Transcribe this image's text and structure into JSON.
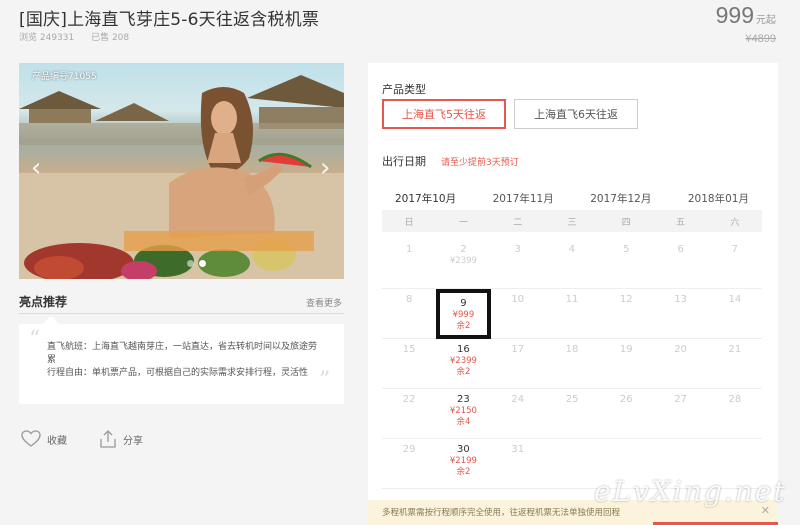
{
  "header": {
    "title": "[国庆]上海直飞芽庄5-6天往返含税机票",
    "views": "浏览 249331",
    "sold": "已售 208",
    "price": "999",
    "price_unit": "元起",
    "original_price": "¥4899"
  },
  "gallery": {
    "product_code": "产品编号71055",
    "prev_glyph": "‹",
    "next_glyph": "›"
  },
  "highlights": {
    "title": "亮点推荐",
    "more": "查看更多",
    "quote_open": "“",
    "quote_close": "”",
    "line1": "直飞航班：上海直飞越南芽庄，一站直达，省去转机时间以及旅途劳累",
    "line2": "行程自由：单机票产品，可根据自己的实际需求安排行程，灵活性"
  },
  "actions": {
    "favorite": "收藏",
    "share": "分享"
  },
  "booking": {
    "type_label": "产品类型",
    "options": [
      "上海直飞5天往返",
      "上海直飞6天往返"
    ],
    "selected_option": "上海直飞5天往返",
    "date_label": "出行日期",
    "date_note": "请至少提前3天预订",
    "months": [
      "2017年10月",
      "2017年11月",
      "2017年12月",
      "2018年01月"
    ],
    "selected_month": "2017年10月",
    "weekdays": [
      "日",
      "一",
      "二",
      "三",
      "四",
      "五",
      "六"
    ],
    "calendar": [
      [
        {
          "d": "1"
        },
        {
          "d": "2",
          "p": "¥2399",
          "past": true
        },
        {
          "d": "3"
        },
        {
          "d": "4"
        },
        {
          "d": "5"
        },
        {
          "d": "6"
        },
        {
          "d": "7"
        }
      ],
      [
        {
          "d": "8"
        },
        {
          "d": "9",
          "p": "¥999",
          "r": "余2",
          "sel": true
        },
        {
          "d": "10"
        },
        {
          "d": "11"
        },
        {
          "d": "12"
        },
        {
          "d": "13"
        },
        {
          "d": "14"
        }
      ],
      [
        {
          "d": "15"
        },
        {
          "d": "16",
          "p": "¥2399",
          "r": "余2"
        },
        {
          "d": "17"
        },
        {
          "d": "18"
        },
        {
          "d": "19"
        },
        {
          "d": "20"
        },
        {
          "d": "21"
        }
      ],
      [
        {
          "d": "22"
        },
        {
          "d": "23",
          "p": "¥2150",
          "r": "余4"
        },
        {
          "d": "24"
        },
        {
          "d": "25"
        },
        {
          "d": "26"
        },
        {
          "d": "27"
        },
        {
          "d": "28"
        }
      ],
      [
        {
          "d": "29"
        },
        {
          "d": "30",
          "p": "¥2199",
          "r": "余2"
        },
        {
          "d": "31"
        },
        {
          "d": ""
        },
        {
          "d": ""
        },
        {
          "d": ""
        },
        {
          "d": ""
        }
      ]
    ]
  },
  "notice": {
    "text": "多程机票需按行程顺序完全使用，往返程机票无法单独使用回程",
    "close": "✕"
  },
  "watermark": "eLvXing.net",
  "colors": {
    "accent": "#e8574b",
    "background": "#f4f4f4",
    "notice_bg": "#fcf3dc"
  }
}
